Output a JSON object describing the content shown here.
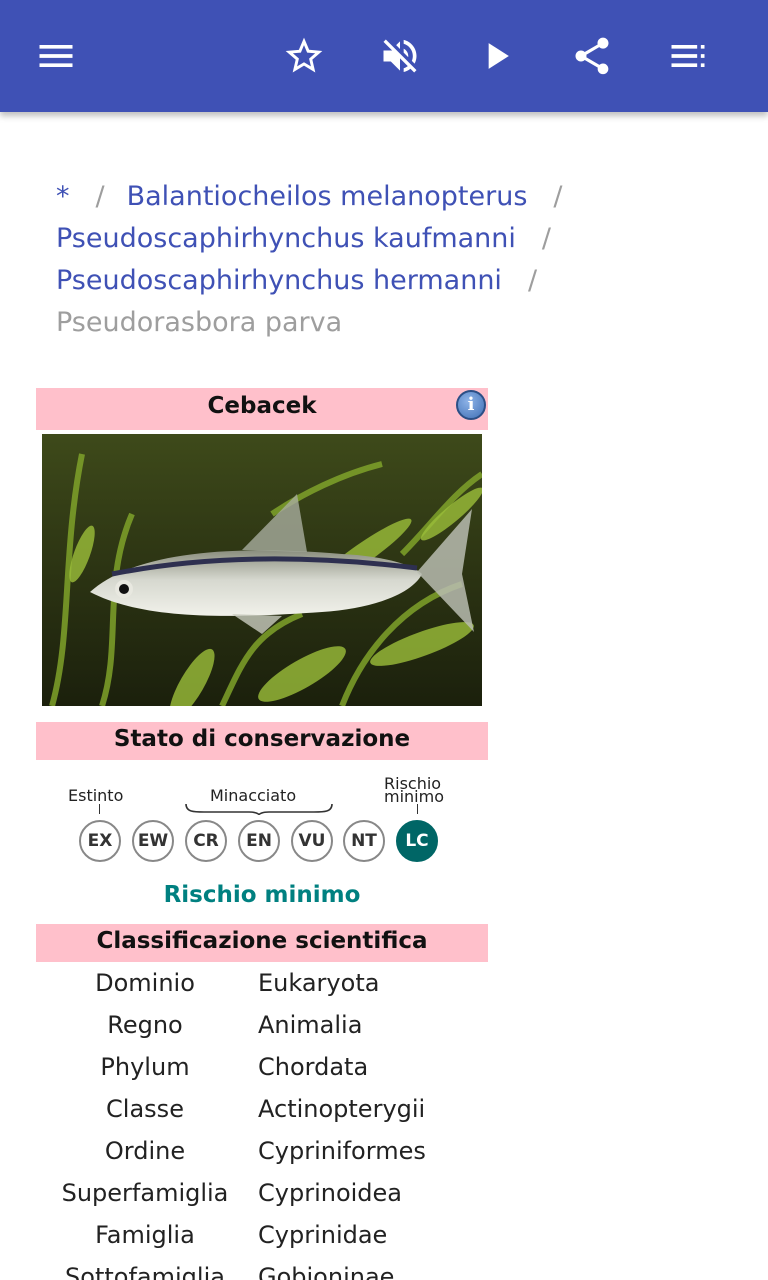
{
  "toolbar": {
    "menu_icon": "menu-icon",
    "favorite_icon": "star-outline-icon",
    "mute_icon": "volume-off-icon",
    "play_icon": "play-icon",
    "share_icon": "share-icon",
    "list_icon": "playlist-icon"
  },
  "breadcrumb": {
    "items": [
      "*",
      "Balantiocheilos melanopterus",
      "Pseudoscaphirhynchus kaufmanni",
      "Pseudoscaphirhynchus hermanni"
    ],
    "separator": "/",
    "current": "Pseudorasbora parva"
  },
  "infobox": {
    "title": "Cebacek",
    "info_icon": "i",
    "status_header": "Stato di conservazione",
    "scale": {
      "extinct_label": "Estinto",
      "threatened_label": "Minacciato",
      "least_concern_label_1": "Rischio",
      "least_concern_label_2": "minimo",
      "codes": [
        "EX",
        "EW",
        "CR",
        "EN",
        "VU",
        "NT",
        "LC"
      ],
      "active": "LC"
    },
    "status_text": "Rischio minimo",
    "classification_header": "Classificazione scientifica",
    "classification": [
      {
        "rank": "Dominio",
        "value": "Eukaryota"
      },
      {
        "rank": "Regno",
        "value": "Animalia"
      },
      {
        "rank": "Phylum",
        "value": "Chordata"
      },
      {
        "rank": "Classe",
        "value": "Actinopterygii"
      },
      {
        "rank": "Ordine",
        "value": "Cypriniformes"
      },
      {
        "rank": "Superfamiglia",
        "value": "Cyprinoidea"
      },
      {
        "rank": "Famiglia",
        "value": "Cyprinidae"
      },
      {
        "rank": "Sottofamiglia",
        "value": "Gobioninae"
      }
    ]
  },
  "colors": {
    "appbar": "#3f51b5",
    "link": "#3f51b5",
    "header_bg": "#ffc0cb",
    "status_color": "#008080"
  }
}
